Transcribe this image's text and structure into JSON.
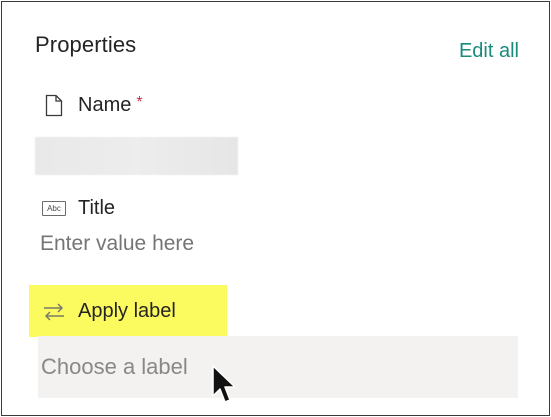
{
  "panel": {
    "title": "Properties",
    "edit_all": "Edit all"
  },
  "fields": {
    "name": {
      "icon": "document-icon",
      "label": "Name",
      "required_marker": "*"
    },
    "title": {
      "icon": "text-field-icon",
      "icon_text": "Abc",
      "label": "Title",
      "placeholder": "Enter value here"
    },
    "apply_label": {
      "icon": "exchange-arrows-icon",
      "label": "Apply label",
      "placeholder": "Choose a label",
      "highlight_color": "#fbfb5f"
    }
  },
  "colors": {
    "accent": "#1a8a7a",
    "required": "#c4314b",
    "placeholder": "#8a8886",
    "field_background": "#f3f2f1"
  }
}
